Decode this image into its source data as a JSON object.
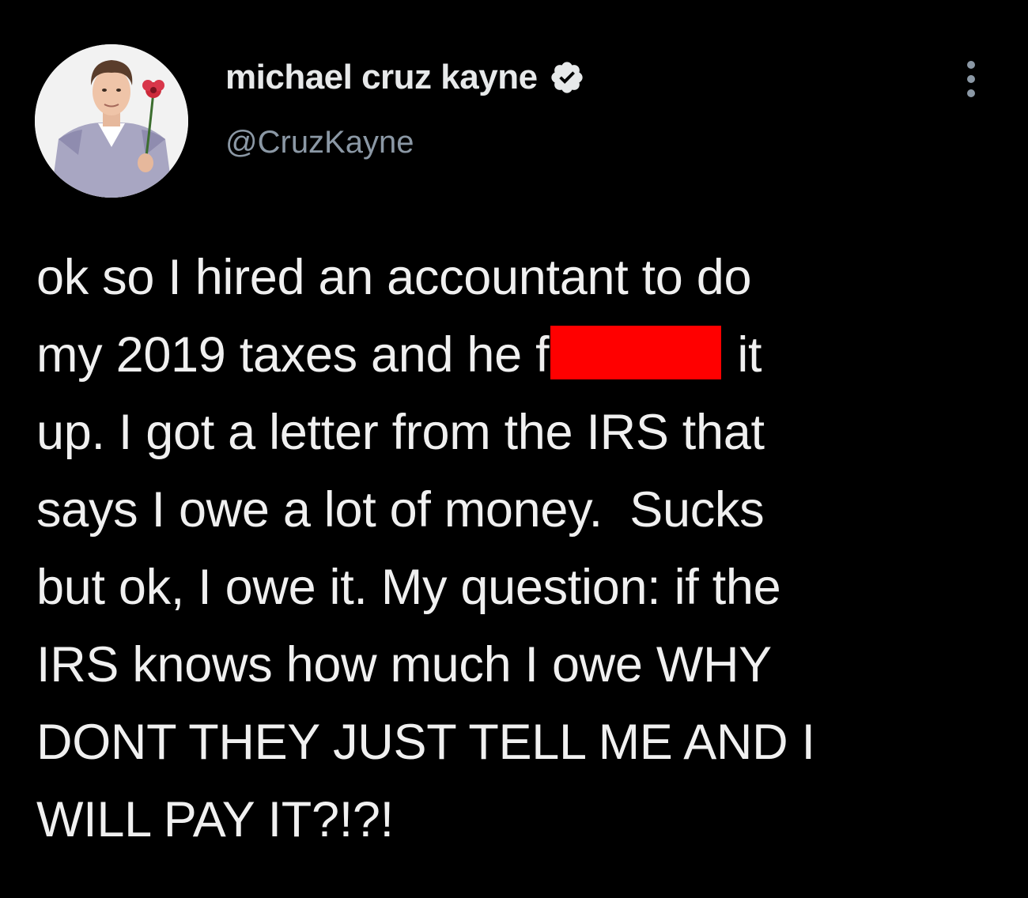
{
  "author": {
    "display_name": "michael cruz kayne",
    "handle": "@CruzKayne",
    "verified": true,
    "avatar_icon": "profile-photo-man-holding-flower"
  },
  "menu": {
    "more_icon": "more-vertical-icon"
  },
  "tweet": {
    "lines": [
      "ok so I hired an accountant to do",
      "my 2019 taxes and he f",
      "it",
      "up. I got a letter from the IRS that",
      "says I owe a lot of money.  Sucks",
      "but ok, I owe it. My question: if the",
      "IRS knows how much I owe WHY",
      "DONT THEY JUST TELL ME AND I",
      "WILL PAY IT?!?!"
    ],
    "redaction_color": "#ff0000"
  },
  "colors": {
    "background": "#000000",
    "primary_text": "#e7e9ea",
    "secondary_text": "#8b98a5"
  }
}
